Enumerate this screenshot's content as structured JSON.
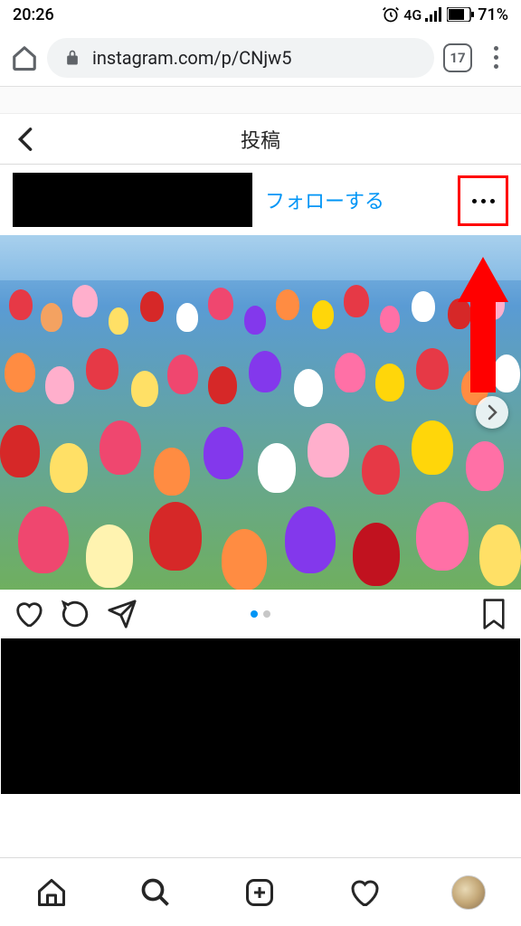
{
  "status": {
    "time": "20:26",
    "network": "4G",
    "battery": "71%"
  },
  "browser": {
    "url": "instagram.com/p/CNjw5",
    "tab_count": "17"
  },
  "ig": {
    "header_title": "投稿",
    "follow_label": "フォローする"
  },
  "carousel": {
    "current": 1,
    "total": 2
  },
  "annotation": {
    "highlight": "more-options-button"
  }
}
